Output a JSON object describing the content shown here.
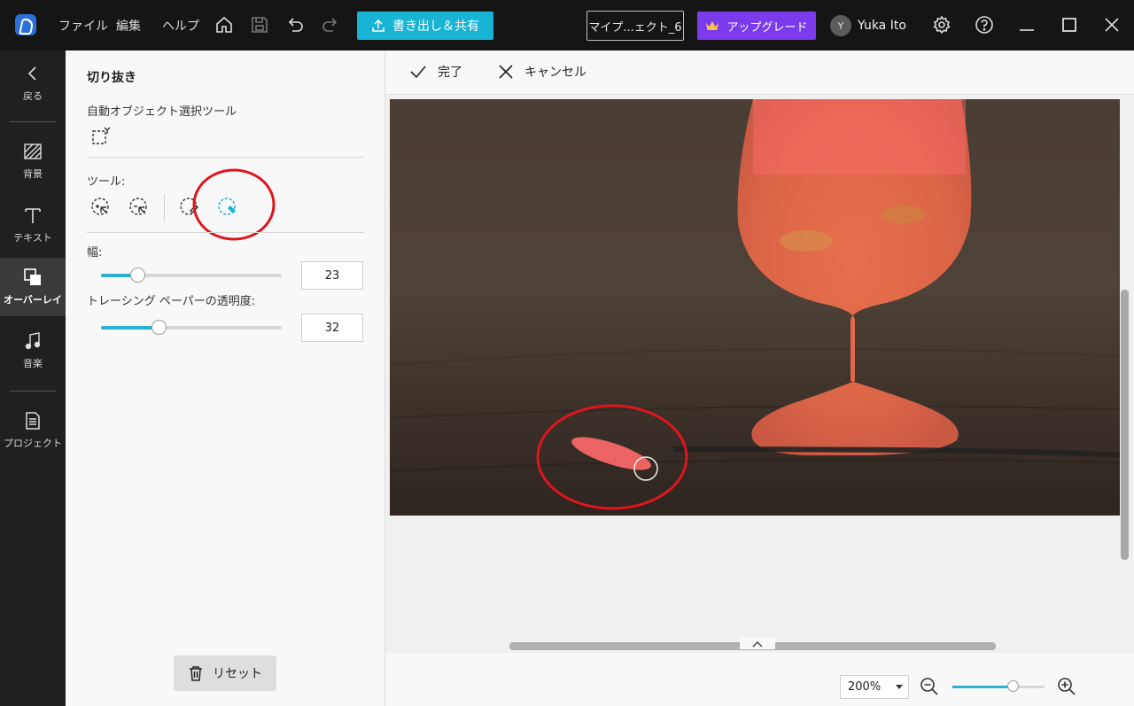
{
  "titlebar": {
    "menu": [
      "ファイル",
      "編集",
      "ヘルプ"
    ],
    "export_label": "書き出し＆共有",
    "project_name": "マイプ...ェクト_6",
    "upgrade_label": "アップグレード",
    "user_initial": "Y",
    "user_name": "Yuka Ito"
  },
  "rail": {
    "back": "戻る",
    "items": [
      "背景",
      "テキスト",
      "オーバーレイ",
      "音楽",
      "プロジェクト"
    ],
    "active": "オーバーレイ"
  },
  "panel": {
    "title": "切り抜き",
    "auto_select_label": "自動オブジェクト選択ツール",
    "tools_label": "ツール:",
    "width_label": "幅:",
    "width_value": "23",
    "width_fraction": 0.2,
    "opacity_label": "トレーシング ペーパーの透明度:",
    "opacity_value": "32",
    "opacity_fraction": 0.32,
    "reset_label": "リセット"
  },
  "canvas": {
    "done_label": "完了",
    "cancel_label": "キャンセル"
  },
  "zoom": {
    "value": "200%",
    "fraction": 0.65
  },
  "colors": {
    "accent": "#19b3d4",
    "upgrade": "#7c3aed",
    "annotation": "#e0141c",
    "mask": "#ff5a5a"
  }
}
